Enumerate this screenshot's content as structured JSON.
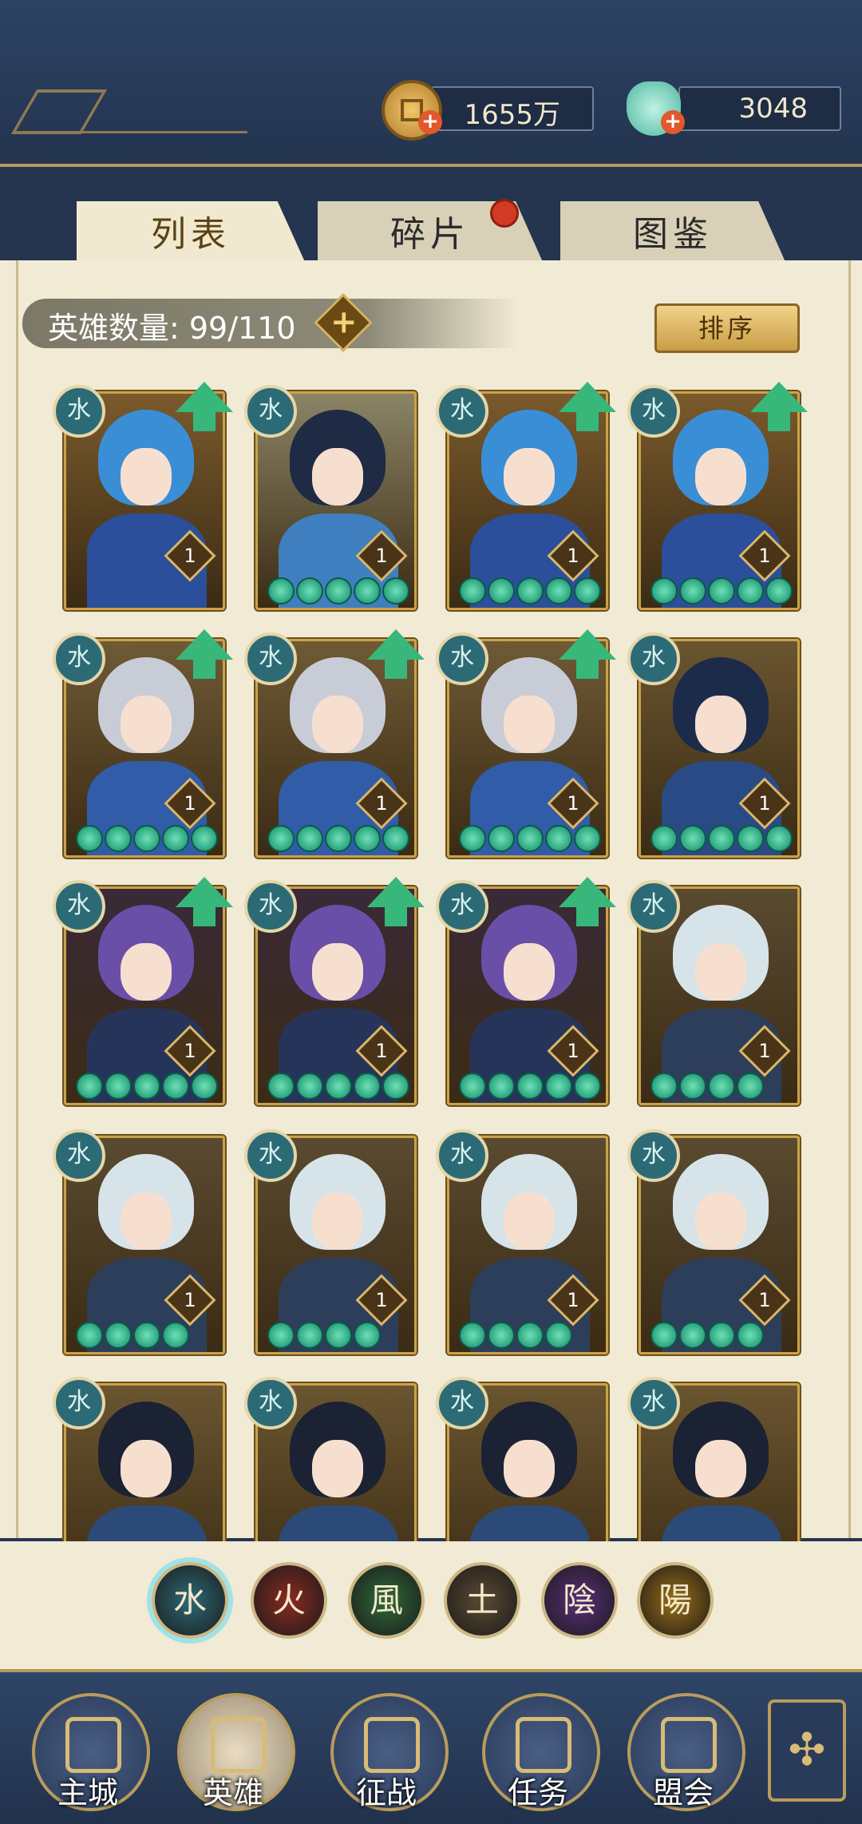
{
  "resources": {
    "coins": "1655万",
    "jade": "3048"
  },
  "tabs": [
    {
      "label": "列表",
      "active": true
    },
    {
      "label": "碎片",
      "active": false,
      "has_notification": true
    },
    {
      "label": "图鉴",
      "active": false
    }
  ],
  "hero_count": {
    "label": "英雄数量: 99/110",
    "add": "+"
  },
  "sort_label": "排序",
  "heroes": [
    {
      "element": "水",
      "level": "1",
      "stars": 0,
      "upgradable": true,
      "variant": "blue-hair-lady"
    },
    {
      "element": "水",
      "level": "1",
      "stars": 5,
      "upgradable": false,
      "variant": "flower-lady"
    },
    {
      "element": "水",
      "level": "1",
      "stars": 5,
      "upgradable": true,
      "variant": "blue-hair-lady"
    },
    {
      "element": "水",
      "level": "1",
      "stars": 5,
      "upgradable": true,
      "variant": "blue-hair-lady"
    },
    {
      "element": "水",
      "level": "1",
      "stars": 5,
      "upgradable": true,
      "variant": "silver-hair"
    },
    {
      "element": "水",
      "level": "1",
      "stars": 5,
      "upgradable": true,
      "variant": "silver-hair"
    },
    {
      "element": "水",
      "level": "1",
      "stars": 5,
      "upgradable": true,
      "variant": "silver-hair"
    },
    {
      "element": "水",
      "level": "1",
      "stars": 5,
      "upgradable": false,
      "variant": "opera-lady"
    },
    {
      "element": "水",
      "level": "1",
      "stars": 5,
      "upgradable": true,
      "variant": "purple-hair"
    },
    {
      "element": "水",
      "level": "1",
      "stars": 5,
      "upgradable": true,
      "variant": "purple-hair"
    },
    {
      "element": "水",
      "level": "1",
      "stars": 5,
      "upgradable": true,
      "variant": "purple-hair"
    },
    {
      "element": "水",
      "level": "1",
      "stars": 4,
      "upgradable": false,
      "variant": "white-hair-armor"
    },
    {
      "element": "水",
      "level": "1",
      "stars": 4,
      "upgradable": false,
      "variant": "white-hair-armor"
    },
    {
      "element": "水",
      "level": "1",
      "stars": 4,
      "upgradable": false,
      "variant": "white-hair-armor"
    },
    {
      "element": "水",
      "level": "1",
      "stars": 4,
      "upgradable": false,
      "variant": "white-hair-armor"
    },
    {
      "element": "水",
      "level": "1",
      "stars": 4,
      "upgradable": false,
      "variant": "white-hair-armor"
    },
    {
      "element": "水",
      "level": "",
      "stars": 0,
      "upgradable": false,
      "variant": "dark-hair-swordsman"
    },
    {
      "element": "水",
      "level": "",
      "stars": 0,
      "upgradable": false,
      "variant": "dark-hair-swordsman"
    },
    {
      "element": "水",
      "level": "",
      "stars": 0,
      "upgradable": false,
      "variant": "dark-hair-swordsman"
    },
    {
      "element": "水",
      "level": "",
      "stars": 0,
      "upgradable": false,
      "variant": "dark-hair-swordsman"
    }
  ],
  "element_filters": [
    {
      "glyph": "水",
      "color": "#2c6a76",
      "active": true
    },
    {
      "glyph": "火",
      "color": "#8a2a20"
    },
    {
      "glyph": "風",
      "color": "#2f6a3a"
    },
    {
      "glyph": "土",
      "color": "#5b4a33"
    },
    {
      "glyph": "陰",
      "color": "#5a2f7a"
    },
    {
      "glyph": "陽",
      "color": "#9c6e16"
    }
  ],
  "bottom_nav": [
    {
      "label": "主城",
      "icon": "city-gate-icon"
    },
    {
      "label": "英雄",
      "icon": "hero-portrait-icon",
      "active": true
    },
    {
      "label": "征战",
      "icon": "campaign-icon"
    },
    {
      "label": "任务",
      "icon": "quest-scroll-icon"
    },
    {
      "label": "盟会",
      "icon": "guild-icon"
    }
  ],
  "colors": {
    "water": "#2c6a76",
    "upgrade_arrow": "#37b77a",
    "star_gem": "#2fbf8f",
    "gold_border": "#c9a24a"
  }
}
